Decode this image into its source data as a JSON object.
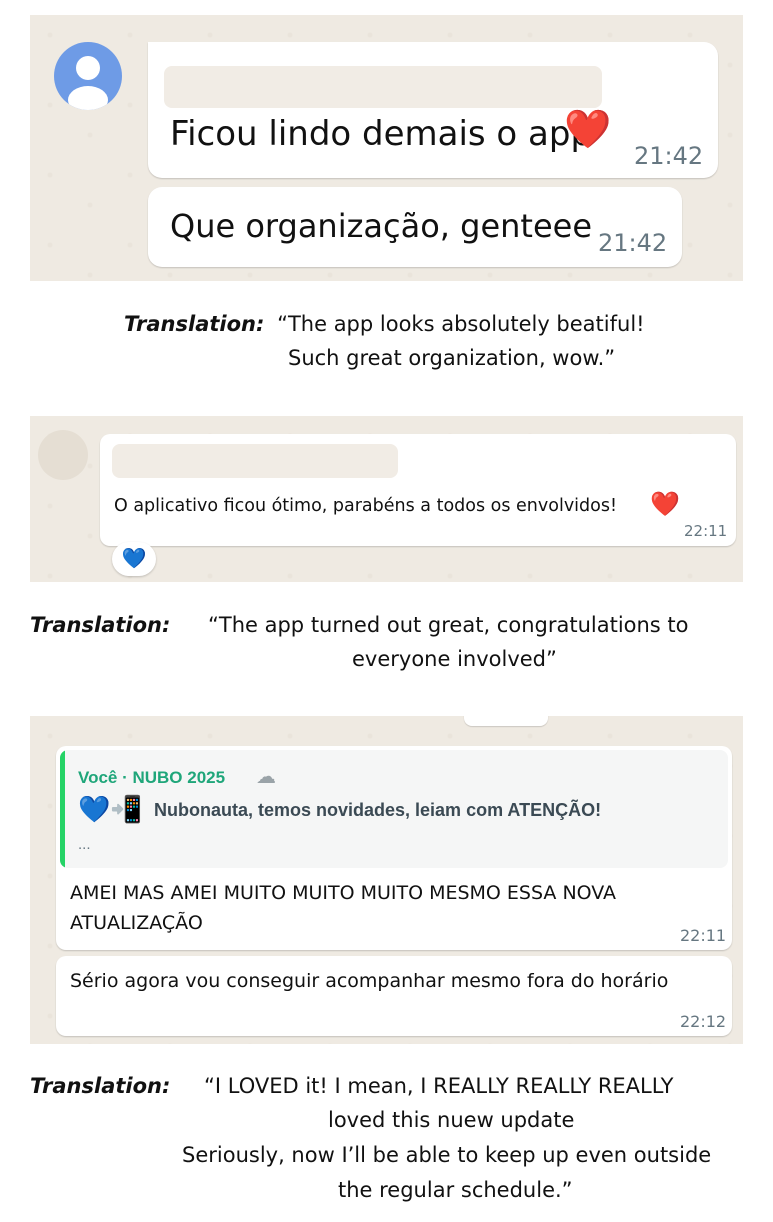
{
  "chat1": {
    "msg1": {
      "text": "Ficou lindo demais o app",
      "emoji": "❤️",
      "time": "21:42"
    },
    "msg2": {
      "text": "Que organização, genteee",
      "time": "21:42"
    }
  },
  "translation1": {
    "label": "Translation:",
    "line1": "“The app looks absolutely beatiful!",
    "line2": "Such great organization, wow.”"
  },
  "chat2": {
    "msg": {
      "text": "O aplicativo ficou ótimo, parabéns a todos os envolvidos!",
      "emoji": "❤️",
      "time": "22:11"
    },
    "reaction": "💙"
  },
  "translation2": {
    "label": "Translation:",
    "line1": "“The app turned out great, congratulations to",
    "line2": "everyone involved”"
  },
  "chat3": {
    "quote": {
      "author": "Você · NUBO 2025",
      "author_emoji": "☁",
      "emojis": "💙📲",
      "text": "Nubonauta, temos novidades, leiam com ATENÇÃO!",
      "ellipsis": "..."
    },
    "msg1": {
      "line1": "AMEI MAS AMEI MUITO MUITO MUITO MESMO ESSA NOVA",
      "line2": "ATUALIZAÇÃO",
      "time": "22:11"
    },
    "msg2": {
      "text": "Sério agora vou conseguir acompanhar mesmo fora do horário",
      "time": "22:12"
    }
  },
  "translation3": {
    "label": "Translation:",
    "line1": "“I LOVED it! I mean, I REALLY REALLY REALLY",
    "line2": "loved this nuew update",
    "line3": "Seriously, now I’ll be able to keep up even outside",
    "line4": "the regular schedule.”"
  },
  "colors": {
    "chat_bg": "#efeae2",
    "bubble": "#ffffff",
    "quote_accent": "#25d366",
    "quote_author": "#1fa67a",
    "time": "#667781",
    "avatar": "#6e9be6"
  }
}
